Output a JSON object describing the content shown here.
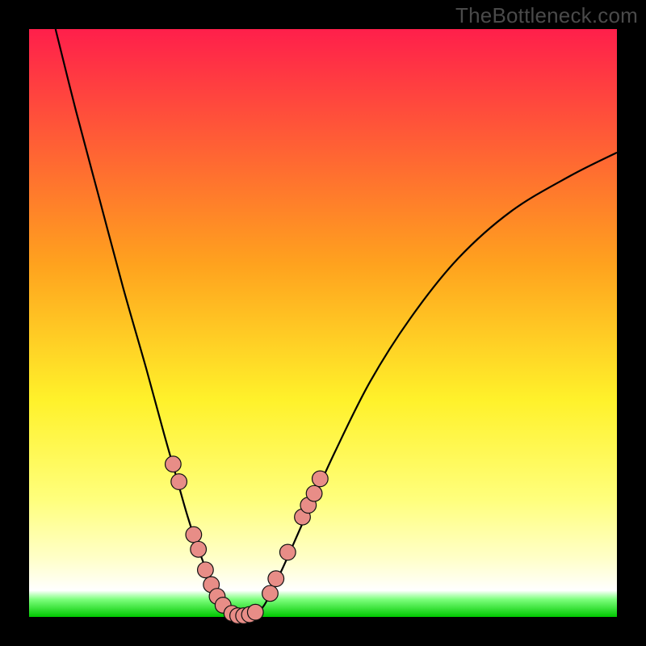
{
  "watermark": "TheBottleneck.com",
  "chart_data": {
    "type": "line",
    "title": "",
    "xlabel": "",
    "ylabel": "",
    "xlim": [
      0,
      100
    ],
    "ylim": [
      0,
      100
    ],
    "background_gradient": {
      "stops": [
        {
          "offset": 0.0,
          "color": "#ff1f4b"
        },
        {
          "offset": 0.4,
          "color": "#ffa21e"
        },
        {
          "offset": 0.63,
          "color": "#fff12a"
        },
        {
          "offset": 0.8,
          "color": "#ffff7c"
        },
        {
          "offset": 0.9,
          "color": "#ffffc8"
        },
        {
          "offset": 0.955,
          "color": "#ffffff"
        },
        {
          "offset": 0.97,
          "color": "#7dff7d"
        },
        {
          "offset": 1.0,
          "color": "#00c800"
        }
      ]
    },
    "series": [
      {
        "name": "left-branch",
        "x": [
          4.5,
          8,
          12,
          16,
          20,
          23,
          25,
          27,
          29,
          31,
          33
        ],
        "y": [
          100,
          86,
          71,
          56,
          42,
          31,
          24,
          17,
          11,
          6,
          2
        ]
      },
      {
        "name": "valley",
        "x": [
          33,
          34.5,
          36,
          38,
          40
        ],
        "y": [
          2,
          0.5,
          0,
          0.5,
          2
        ]
      },
      {
        "name": "right-branch",
        "x": [
          40,
          43,
          47,
          52,
          58,
          65,
          73,
          82,
          92,
          100
        ],
        "y": [
          2,
          8,
          17,
          28,
          40,
          51,
          61,
          69,
          75,
          79
        ]
      }
    ],
    "markers_left": [
      {
        "x": 24.5,
        "y": 26
      },
      {
        "x": 25.5,
        "y": 23
      },
      {
        "x": 28.0,
        "y": 14
      },
      {
        "x": 28.8,
        "y": 11.5
      },
      {
        "x": 30.0,
        "y": 8
      },
      {
        "x": 31.0,
        "y": 5.5
      },
      {
        "x": 32.0,
        "y": 3.5
      },
      {
        "x": 33.0,
        "y": 2
      }
    ],
    "markers_valley": [
      {
        "x": 34.5,
        "y": 0.6
      },
      {
        "x": 35.5,
        "y": 0.2
      },
      {
        "x": 36.5,
        "y": 0.2
      },
      {
        "x": 37.5,
        "y": 0.4
      },
      {
        "x": 38.5,
        "y": 0.8
      }
    ],
    "markers_right": [
      {
        "x": 41.0,
        "y": 4
      },
      {
        "x": 42.0,
        "y": 6.5
      },
      {
        "x": 44.0,
        "y": 11
      },
      {
        "x": 46.5,
        "y": 17
      },
      {
        "x": 47.5,
        "y": 19
      },
      {
        "x": 48.5,
        "y": 21
      },
      {
        "x": 49.5,
        "y": 23.5
      }
    ],
    "marker_style": {
      "fill": "#e88d87",
      "stroke": "#111111",
      "r": 1.35
    }
  }
}
